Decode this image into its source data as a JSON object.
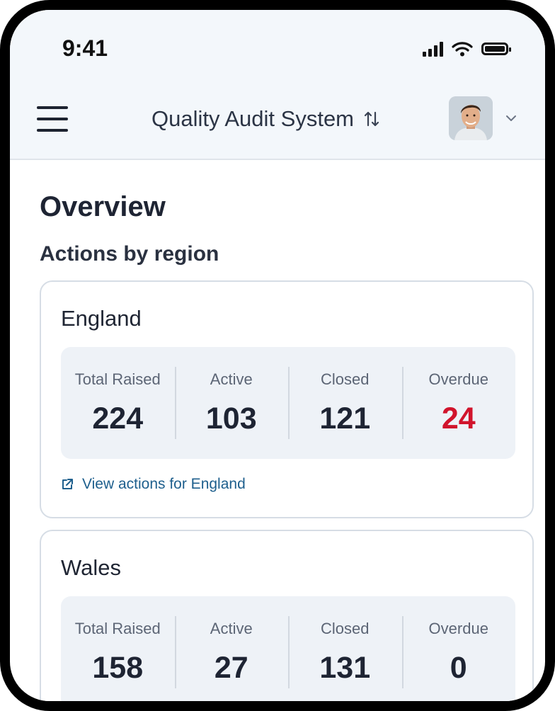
{
  "status_bar": {
    "time": "9:41"
  },
  "header": {
    "menu_icon": "hamburger-icon",
    "title": "Quality Audit System",
    "switch_icon": "swap-vertical-icon",
    "avatar_icon": "user-avatar",
    "dropdown_icon": "chevron-down-icon"
  },
  "page": {
    "title": "Overview",
    "section_title": "Actions by region"
  },
  "stat_labels": {
    "total": "Total Raised",
    "active": "Active",
    "closed": "Closed",
    "overdue": "Overdue"
  },
  "regions": [
    {
      "name": "England",
      "total": "224",
      "active": "103",
      "closed": "121",
      "overdue": "24",
      "overdue_color": "#d1142c",
      "link": "View actions for England"
    },
    {
      "name": "Wales",
      "total": "158",
      "active": "27",
      "closed": "131",
      "overdue": "0",
      "overdue_color": "#1e2433"
    }
  ],
  "colors": {
    "header_bg": "#f3f7fb",
    "link": "#1e5f8d",
    "overdue_alert": "#d1142c",
    "stats_bg": "#eef2f7"
  }
}
